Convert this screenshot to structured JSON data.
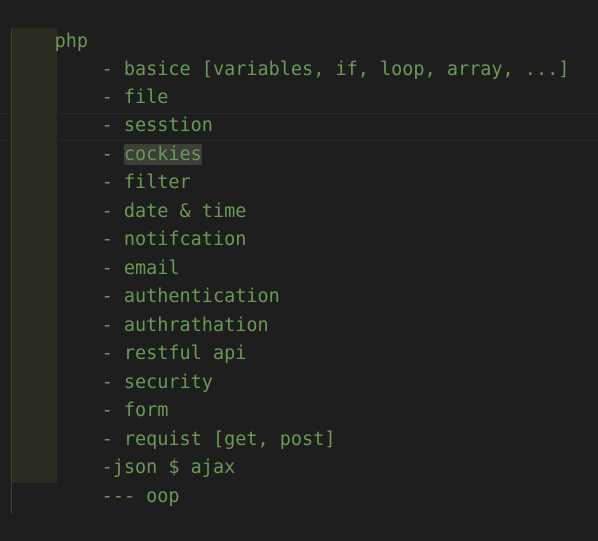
{
  "editor": {
    "first_line": "php",
    "items": [
      {
        "prefix": "- ",
        "text": "basice [variables, if, loop, array, ...]"
      },
      {
        "prefix": "- ",
        "text": "file"
      },
      {
        "prefix": "- ",
        "text": "sesstion"
      },
      {
        "prefix": "- ",
        "text": "cockies"
      },
      {
        "prefix": "- ",
        "text": "filter"
      },
      {
        "prefix": "- ",
        "text": "date & time"
      },
      {
        "prefix": "- ",
        "text": "notifcation"
      },
      {
        "prefix": "- ",
        "text": "email"
      },
      {
        "prefix": "- ",
        "text": "authentication"
      },
      {
        "prefix": "- ",
        "text": "authrathation"
      },
      {
        "prefix": "- ",
        "text": "restful api"
      },
      {
        "prefix": "- ",
        "text": "security"
      },
      {
        "prefix": "- ",
        "text": "form"
      },
      {
        "prefix": "- ",
        "text": "requist [get, post]"
      }
    ],
    "json_line": "-json $ ajax",
    "oop_line": "--- oop",
    "closing_line": "*/",
    "comment_color": "#6a9955",
    "background_color": "#1e1e1e"
  }
}
